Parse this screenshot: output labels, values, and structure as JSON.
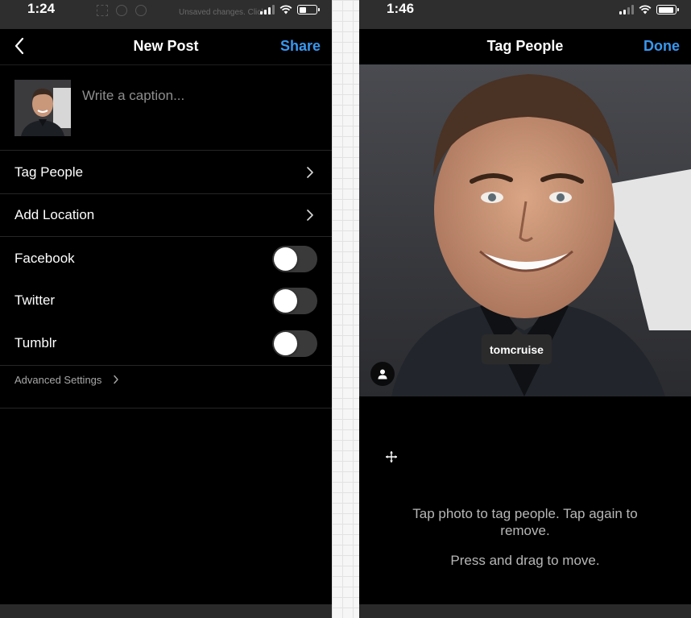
{
  "left_screen": {
    "status_time": "1:24",
    "ghost_note": "Unsaved changes. Click...",
    "nav": {
      "title": "New Post",
      "action": "Share"
    },
    "caption": {
      "placeholder": "Write a caption..."
    },
    "menu": [
      {
        "label": "Tag People"
      },
      {
        "label": "Add Location"
      }
    ],
    "share_to": [
      {
        "label": "Facebook",
        "enabled": false
      },
      {
        "label": "Twitter",
        "enabled": false
      },
      {
        "label": "Tumblr",
        "enabled": false
      }
    ],
    "advanced_label": "Advanced Settings"
  },
  "right_screen": {
    "status_time": "1:46",
    "nav": {
      "title": "Tag People",
      "action": "Done"
    },
    "tag_label": "tomcruise",
    "hint_line1": "Tap photo to tag people. Tap again to remove.",
    "hint_line2": "Press and drag to move."
  },
  "colors": {
    "accent": "#3897f0",
    "background": "#000000",
    "toggle_off": "#3a3a3a",
    "secondary_text": "#8e8e8e"
  },
  "icons": {
    "back": "chevron-left-icon",
    "row_chevron": "chevron-right-icon",
    "person": "person-icon",
    "move": "move-cursor-icon"
  }
}
